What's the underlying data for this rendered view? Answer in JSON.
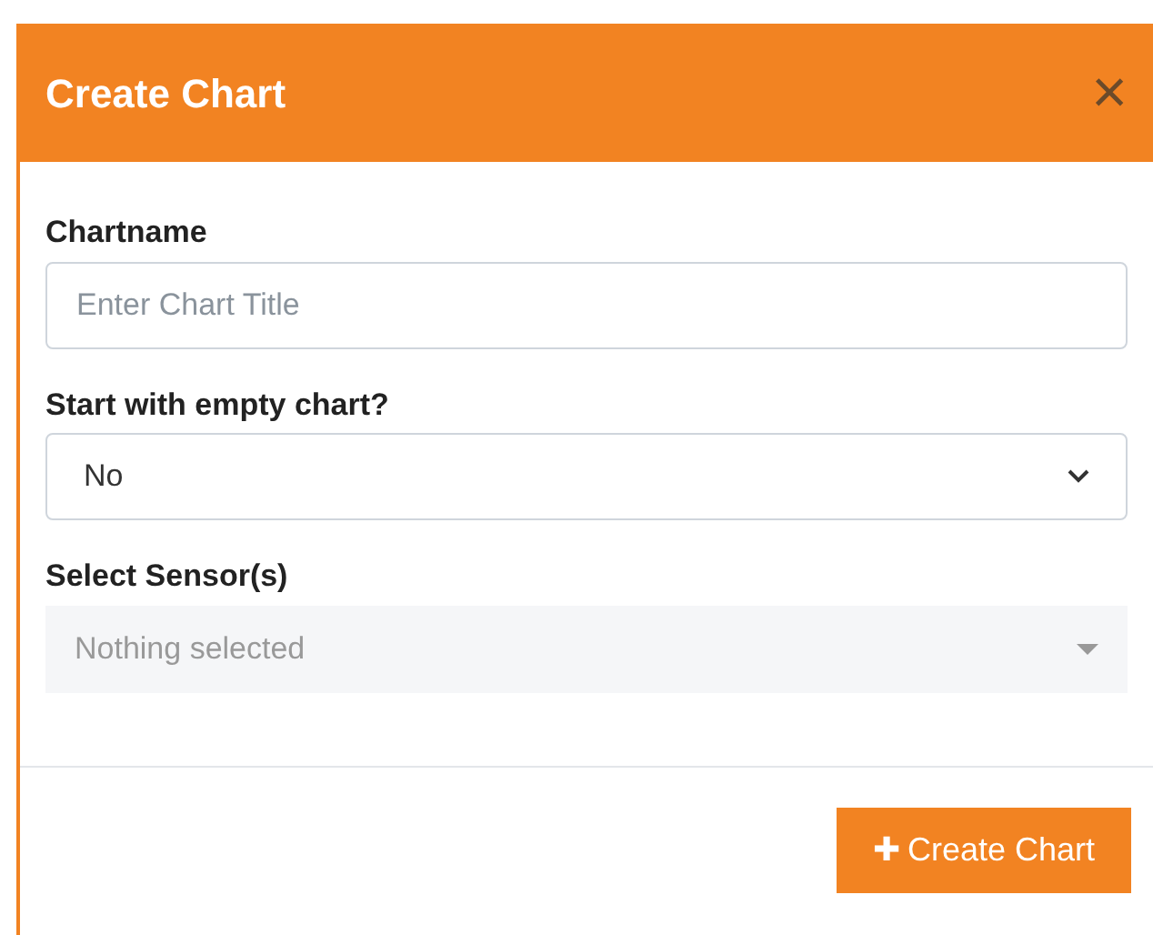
{
  "dialog": {
    "title": "Create Chart",
    "close_label": "×"
  },
  "fields": [
    {
      "kind": "text",
      "label": "Chartname",
      "placeholder": "Enter Chart Title"
    },
    {
      "kind": "select",
      "label": "Start with empty chart?",
      "value": "No",
      "disabled": false
    },
    {
      "kind": "picker",
      "label": "Select Sensor(s)",
      "placeholder": "Nothing selected",
      "disabled": true
    }
  ],
  "submit": {
    "icon": "✚",
    "label": "Create Chart"
  }
}
